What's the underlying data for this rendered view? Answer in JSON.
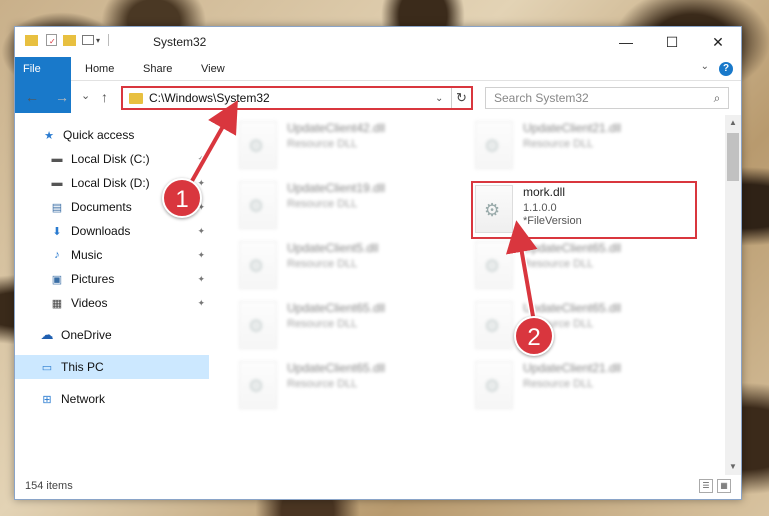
{
  "window": {
    "title": "System32",
    "controls": {
      "minimize": "—",
      "maximize": "☐",
      "close": "✕"
    }
  },
  "ribbon": {
    "tabs": [
      "File",
      "Home",
      "Share",
      "View"
    ],
    "help": "?"
  },
  "nav": {
    "back": "←",
    "forward": "→",
    "recent": "⌄",
    "up": "↑",
    "address": "C:\\Windows\\System32",
    "refresh": "↻",
    "search_placeholder": "Search System32",
    "search_icon": "⌕"
  },
  "sidebar": {
    "items": [
      {
        "label": "Quick access",
        "icon": "★"
      },
      {
        "label": "Local Disk (C:)",
        "icon": "▬"
      },
      {
        "label": "Local Disk (D:)",
        "icon": "▬"
      },
      {
        "label": "Documents",
        "icon": "▤"
      },
      {
        "label": "Downloads",
        "icon": "⬇"
      },
      {
        "label": "Music",
        "icon": "♪"
      },
      {
        "label": "Pictures",
        "icon": "▣"
      },
      {
        "label": "Videos",
        "icon": "▦"
      },
      {
        "label": "OneDrive",
        "icon": "☁"
      },
      {
        "label": "This PC",
        "icon": "▭"
      },
      {
        "label": "Network",
        "icon": "⊞"
      }
    ],
    "pin": "📌"
  },
  "files": [
    {
      "name": "UpdateClient42.dll",
      "meta": "Resource DLL"
    },
    {
      "name": "UpdateClient21.dll",
      "meta": "Resource DLL"
    },
    {
      "name": "UpdateClient19.dll",
      "meta": "Resource DLL"
    },
    {
      "name": "mork.dll",
      "version": "1.1.0.0",
      "meta": "*FileVersion"
    },
    {
      "name": "UpdateClient5.dll",
      "meta": "Resource DLL"
    },
    {
      "name": "UpdateClient65.dll",
      "meta": "Resource DLL"
    },
    {
      "name": "UpdateClient65.dll",
      "meta": "Resource DLL"
    },
    {
      "name": "UpdateClient65.dll",
      "meta": "Resource DLL"
    },
    {
      "name": "UpdateClient65.dll",
      "meta": "Resource DLL"
    },
    {
      "name": "UpdateClient21.dll",
      "meta": "Resource DLL"
    }
  ],
  "status": {
    "count": "154 items"
  },
  "annotations": {
    "step1": "1",
    "step2": "2"
  },
  "colors": {
    "accent": "#1979ca",
    "highlight": "#d9363e",
    "selection": "#cce8ff"
  }
}
